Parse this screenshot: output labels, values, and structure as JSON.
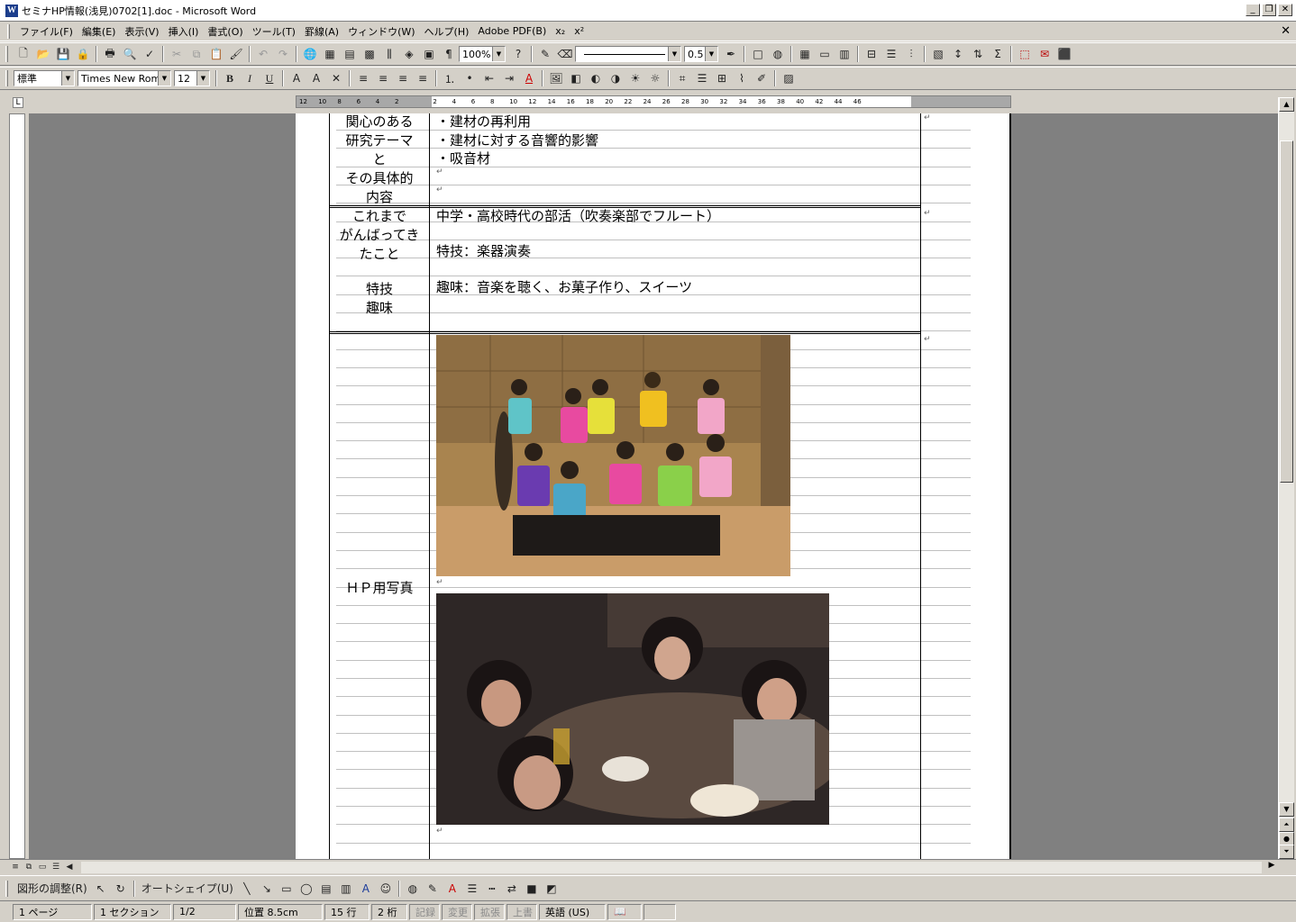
{
  "window": {
    "title": "セミナHP情報(浅見)0702[1].doc - Microsoft Word",
    "app_icon": "W"
  },
  "menu": [
    "ファイル(F)",
    "編集(E)",
    "表示(V)",
    "挿入(I)",
    "書式(O)",
    "ツール(T)",
    "罫線(A)",
    "ウィンドウ(W)",
    "ヘルプ(H)",
    "Adobe PDF(B)",
    "x₂",
    "x²"
  ],
  "toolbar1": {
    "zoom": "100%",
    "line_weight": "0.5"
  },
  "toolbar2": {
    "style": "標準",
    "font": "Times New Roma",
    "size": "12",
    "bold": "B",
    "italic": "I",
    "underline": "U"
  },
  "ruler": {
    "numbers": [
      "12",
      "10",
      "8",
      "6",
      "4",
      "2",
      "",
      "2",
      "4",
      "6",
      "8",
      "10",
      "12",
      "14",
      "16",
      "18",
      "20",
      "22",
      "24",
      "26",
      "28",
      "30",
      "32",
      "34",
      "36",
      "38",
      "40",
      "42",
      "44",
      "46"
    ]
  },
  "document": {
    "row1": {
      "label": [
        "関心のある",
        "研究テーマ",
        "と",
        "その具体的",
        "内容"
      ],
      "items": [
        "・建材の再利用",
        "・建材に対する音響的影響",
        "・吸音材"
      ]
    },
    "row2": {
      "label": [
        "これまで",
        "がんばってき",
        "たこと",
        "",
        "特技",
        "趣味"
      ],
      "lines": [
        "中学・高校時代の部活（吹奏楽部でフルート）",
        "特技：楽器演奏",
        "趣味：音楽を聴く、お菓子作り、スイーツ"
      ]
    },
    "row3": {
      "label": "ＨＰ用写真"
    }
  },
  "drawbar": {
    "adjust": "図形の調整(R)",
    "autoshape": "オートシェイプ(U)"
  },
  "status": {
    "page": "1 ページ",
    "section": "1 セクション",
    "pages": "1/2",
    "position": "位置 8.5cm",
    "line": "15 行",
    "col": "2 桁",
    "rec": "記録",
    "trk": "変更",
    "ext": "拡張",
    "ovr": "上書",
    "lang": "英語 (US)"
  }
}
